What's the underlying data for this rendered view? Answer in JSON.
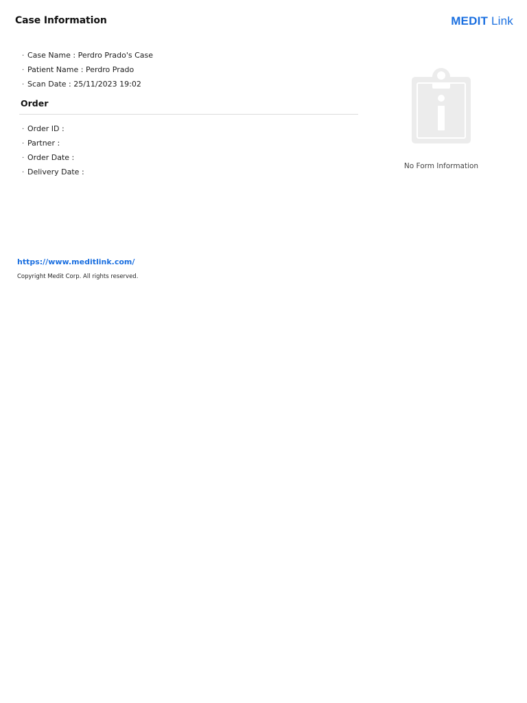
{
  "header": {
    "title": "Case Information",
    "logo_brand": "MEDIT",
    "logo_product": " Link"
  },
  "case_info": [
    {
      "label": "Case Name",
      "value": "Perdro Prado's Case"
    },
    {
      "label": "Patient Name",
      "value": "Perdro Prado"
    },
    {
      "label": "Scan Date",
      "value": "25/11/2023 19:02"
    }
  ],
  "order": {
    "title": "Order",
    "fields": [
      {
        "label": "Order ID",
        "value": ""
      },
      {
        "label": "Partner",
        "value": ""
      },
      {
        "label": "Order Date",
        "value": ""
      },
      {
        "label": "Delivery Date",
        "value": ""
      }
    ]
  },
  "form_panel": {
    "icon": "clipboard-info-icon",
    "empty_text": "No Form Information"
  },
  "footer": {
    "link_text": "https://www.meditlink.com/",
    "copyright": "Copyright Medit Corp. All rights reserved."
  },
  "colors": {
    "brand_blue": "#1a6fe0",
    "divider": "#dcdcdc",
    "icon_gray": "#ececec"
  }
}
